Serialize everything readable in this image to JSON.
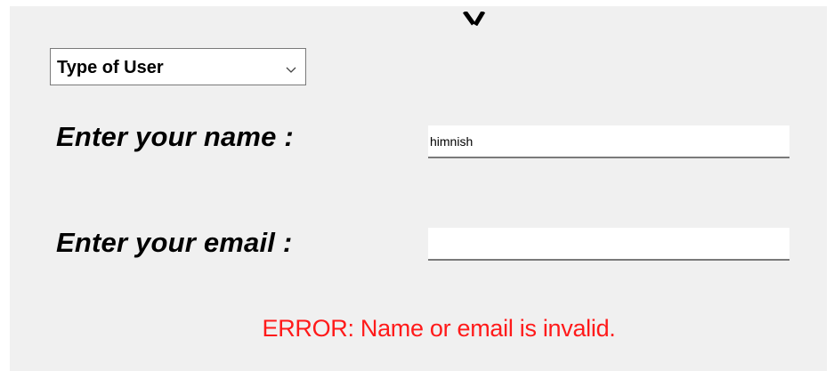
{
  "form": {
    "user_type_select": {
      "selected": "Type of User"
    },
    "name": {
      "label": "Enter your name :",
      "value": "himnish"
    },
    "email": {
      "label": "Enter your email :",
      "value": ""
    },
    "error": "ERROR: Name or email is invalid."
  },
  "colors": {
    "panel_background": "#f0f0f0",
    "error_text": "#ff1a1a",
    "field_border": "#7a7a7a"
  }
}
